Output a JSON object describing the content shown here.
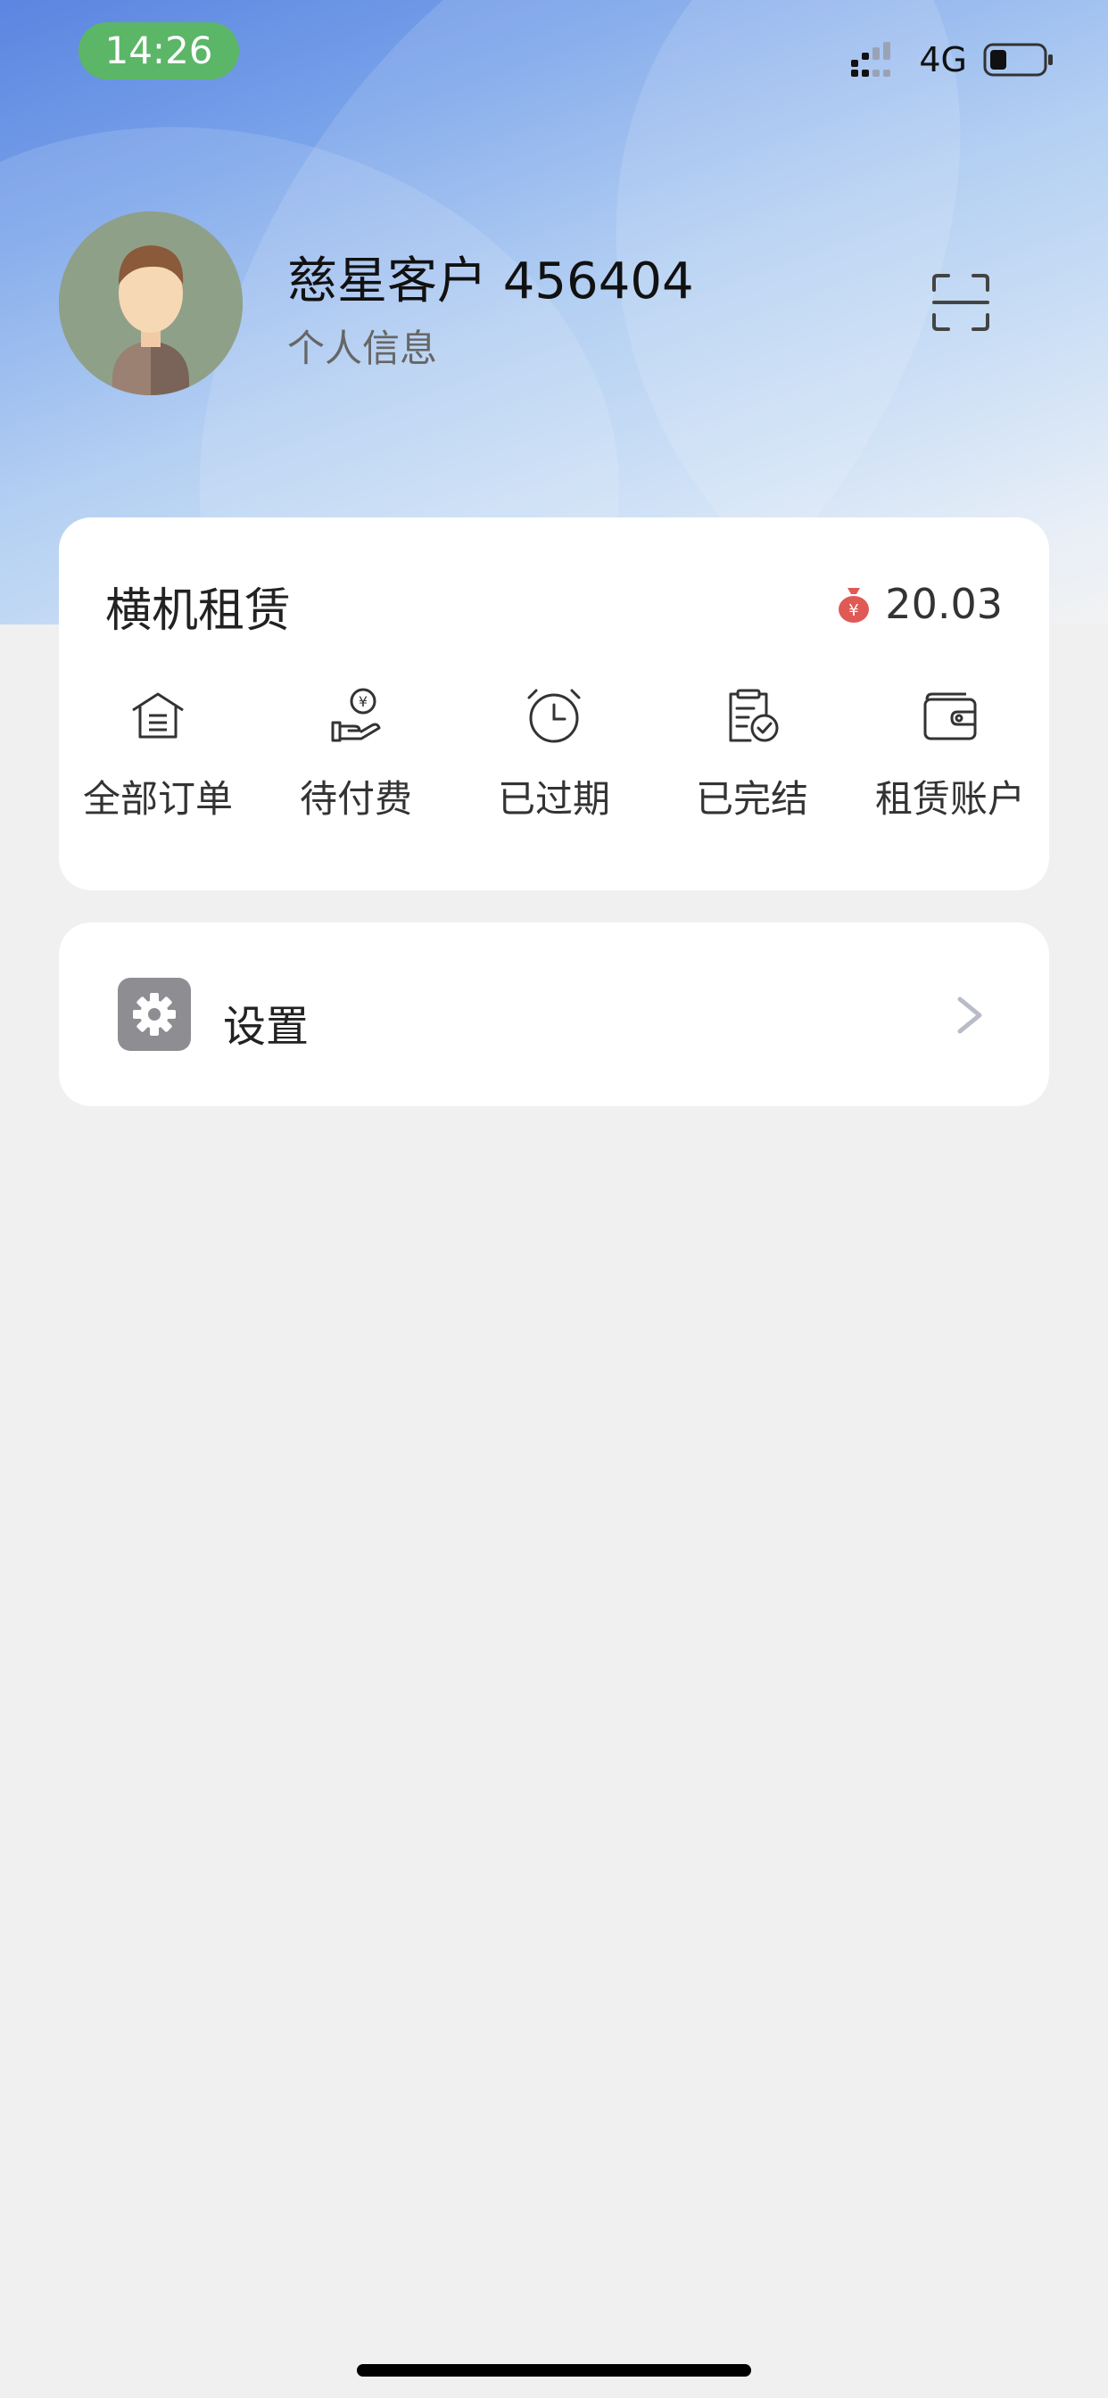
{
  "status_bar": {
    "time": "14:26",
    "network": "4G"
  },
  "profile": {
    "name": "慈星客户 456404",
    "subtitle": "个人信息"
  },
  "rental": {
    "title": "横机租赁",
    "balance": "20.03",
    "actions": [
      {
        "label": "全部订单",
        "icon": "orders-icon"
      },
      {
        "label": "待付费",
        "icon": "payment-pending-icon"
      },
      {
        "label": "已过期",
        "icon": "alarm-clock-icon"
      },
      {
        "label": "已完结",
        "icon": "completed-document-icon"
      },
      {
        "label": "租赁账户",
        "icon": "wallet-icon"
      }
    ]
  },
  "settings": {
    "label": "设置"
  },
  "colors": {
    "accent_green": "#5bb667",
    "balance_red": "#e05a55",
    "settings_icon_bg": "#8d8d92"
  }
}
